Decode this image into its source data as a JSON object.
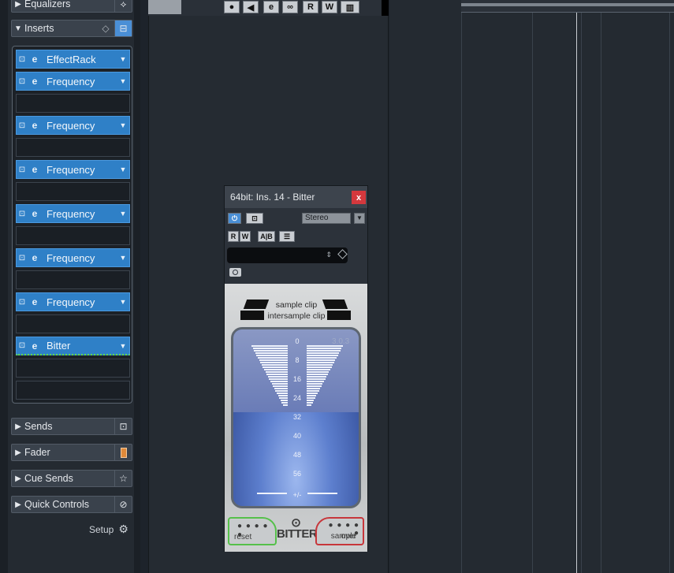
{
  "inspector": {
    "equalizers": {
      "label": "Equalizers",
      "icon": "eq-icon"
    },
    "inserts": {
      "label": "Inserts"
    },
    "slots": [
      {
        "name": "EffectRack",
        "filled": true
      },
      {
        "name": "Frequency",
        "filled": true
      },
      {
        "name": "",
        "filled": false
      },
      {
        "name": "Frequency",
        "filled": true
      },
      {
        "name": "",
        "filled": false
      },
      {
        "name": "Frequency",
        "filled": true
      },
      {
        "name": "",
        "filled": false
      },
      {
        "name": "Frequency",
        "filled": true
      },
      {
        "name": "",
        "filled": false
      },
      {
        "name": "Frequency",
        "filled": true
      },
      {
        "name": "",
        "filled": false
      },
      {
        "name": "Frequency",
        "filled": true
      },
      {
        "name": "",
        "filled": false
      },
      {
        "name": "Bitter",
        "filled": true,
        "selected": true
      },
      {
        "name": "",
        "filled": false
      },
      {
        "name": "",
        "filled": false
      }
    ],
    "sends": {
      "label": "Sends"
    },
    "fader": {
      "label": "Fader"
    },
    "cue_sends": {
      "label": "Cue Sends"
    },
    "quick_controls": {
      "label": "Quick Controls"
    },
    "setup_label": "Setup"
  },
  "transport": {
    "rec": "●",
    "mon": "◀",
    "e": "e",
    "link": "∞",
    "r": "R",
    "w": "W"
  },
  "plugin": {
    "title": "64bit: Ins. 14 - Bitter",
    "close": "x",
    "stereo": "Stereo",
    "rw": {
      "r": "R",
      "w": "W"
    },
    "ab": "A|B",
    "bitter": {
      "clip_line1": "sample clip",
      "clip_line2": "intersample clip",
      "version": "3.0.3",
      "scale": [
        "0",
        "8",
        "16",
        "24",
        "32",
        "40",
        "48",
        "56",
        "+/-"
      ],
      "reset": "reset",
      "over_line1": "over",
      "over_line2": "sample",
      "logo": "BITTER"
    }
  },
  "colors": {
    "accent": "#2f80c7",
    "close": "#d4383d",
    "reset_border": "#55c04a",
    "over_border": "#c7363b"
  }
}
